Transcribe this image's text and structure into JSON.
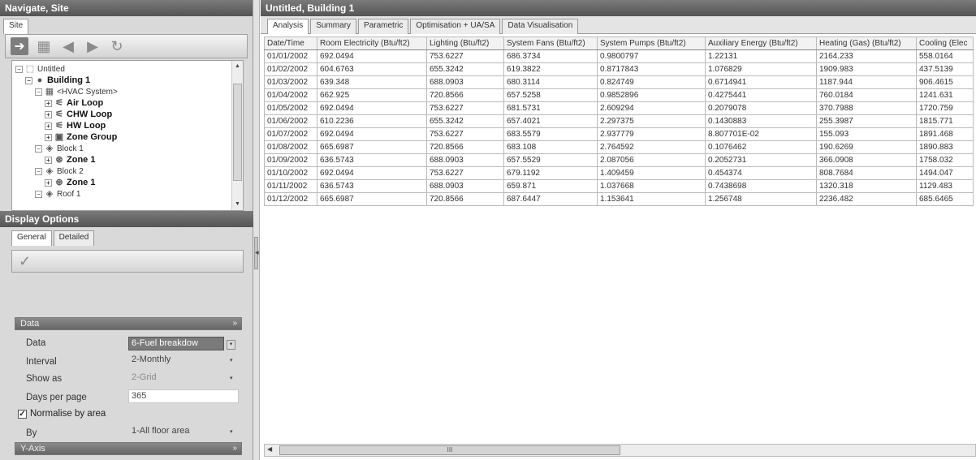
{
  "left_panel": {
    "title": "Navigate, Site",
    "tab": "Site",
    "tree": [
      {
        "label": "Untitled",
        "bold": false,
        "icon": "site-icon",
        "glyph": "⬚"
      },
      {
        "label": "Building 1",
        "bold": true,
        "icon": "building-icon",
        "glyph": "●"
      },
      {
        "label": "<HVAC System>",
        "bold": false,
        "icon": "hvac-icon",
        "glyph": "▦"
      },
      {
        "label": "Air Loop",
        "bold": true,
        "icon": "loop-icon",
        "glyph": "⚟"
      },
      {
        "label": "CHW Loop",
        "bold": true,
        "icon": "loop-icon",
        "glyph": "⚟"
      },
      {
        "label": "HW Loop",
        "bold": true,
        "icon": "loop-icon",
        "glyph": "⚟"
      },
      {
        "label": "Zone Group",
        "bold": true,
        "icon": "zone-group-icon",
        "glyph": "▣"
      },
      {
        "label": "Block 1",
        "bold": false,
        "icon": "block-icon",
        "glyph": "◈"
      },
      {
        "label": "Zone 1",
        "bold": true,
        "icon": "zone-icon",
        "glyph": "⊛"
      },
      {
        "label": "Block 2",
        "bold": false,
        "icon": "block-icon",
        "glyph": "◈"
      },
      {
        "label": "Zone 1",
        "bold": true,
        "icon": "zone-icon",
        "glyph": "⊛"
      },
      {
        "label": "Roof 1",
        "bold": false,
        "icon": "roof-icon",
        "glyph": "◈"
      }
    ]
  },
  "display_options": {
    "title": "Display Options",
    "tabs": [
      "General",
      "Detailed"
    ],
    "data_group": "Data",
    "fields": {
      "data": {
        "label": "Data",
        "value": "6-Fuel breakdow"
      },
      "interval": {
        "label": "Interval",
        "value": "2-Monthly"
      },
      "show_as": {
        "label": "Show as",
        "value": "2-Grid"
      },
      "days_per_page": {
        "label": "Days per page",
        "value": "365"
      },
      "normalise": {
        "label": "Normalise by area",
        "checked": true
      },
      "by": {
        "label": "By",
        "value": "1-All floor area"
      }
    },
    "y_axis_group": "Y-Axis"
  },
  "right_panel": {
    "title": "Untitled, Building 1",
    "tabs": [
      "Analysis",
      "Summary",
      "Parametric",
      "Optimisation + UA/SA",
      "Data Visualisation"
    ],
    "active_tab": "Analysis",
    "table": {
      "columns": [
        "Date/Time",
        "Room Electricity (Btu/ft2)",
        "Lighting (Btu/ft2)",
        "System Fans (Btu/ft2)",
        "System Pumps (Btu/ft2)",
        "Auxiliary Energy (Btu/ft2)",
        "Heating (Gas) (Btu/ft2)",
        "Cooling (Elec"
      ],
      "rows": [
        [
          "01/01/2002",
          "692.0494",
          "753.6227",
          "686.3734",
          "0.9800797",
          "1.22131",
          "2164.233",
          "558.0164"
        ],
        [
          "01/02/2002",
          "604.6763",
          "655.3242",
          "619.3822",
          "0.8717843",
          "1.076829",
          "1909.983",
          "437.5139"
        ],
        [
          "01/03/2002",
          "639.348",
          "688.0903",
          "680.3114",
          "0.824749",
          "0.6714941",
          "1187.944",
          "906.4615"
        ],
        [
          "01/04/2002",
          "662.925",
          "720.8566",
          "657.5258",
          "0.9852896",
          "0.4275441",
          "760.0184",
          "1241.631"
        ],
        [
          "01/05/2002",
          "692.0494",
          "753.6227",
          "681.5731",
          "2.609294",
          "0.2079078",
          "370.7988",
          "1720.759"
        ],
        [
          "01/06/2002",
          "610.2236",
          "655.3242",
          "657.4021",
          "2.297375",
          "0.1430883",
          "255.3987",
          "1815.771"
        ],
        [
          "01/07/2002",
          "692.0494",
          "753.6227",
          "683.5579",
          "2.937779",
          "8.807701E-02",
          "155.093",
          "1891.468"
        ],
        [
          "01/08/2002",
          "665.6987",
          "720.8566",
          "683.108",
          "2.764592",
          "0.1076462",
          "190.6269",
          "1890.883"
        ],
        [
          "01/09/2002",
          "636.5743",
          "688.0903",
          "657.5529",
          "2.087056",
          "0.2052731",
          "366.0908",
          "1758.032"
        ],
        [
          "01/10/2002",
          "692.0494",
          "753.6227",
          "679.1192",
          "1.409459",
          "0.454374",
          "808.7684",
          "1494.047"
        ],
        [
          "01/11/2002",
          "636.5743",
          "688.0903",
          "659.871",
          "1.037668",
          "0.7438698",
          "1320.318",
          "1129.483"
        ],
        [
          "01/12/2002",
          "665.6987",
          "720.8566",
          "687.6447",
          "1.153641",
          "1.256748",
          "2236.482",
          "685.6465"
        ]
      ]
    },
    "scroll_thumb_label": "III"
  }
}
